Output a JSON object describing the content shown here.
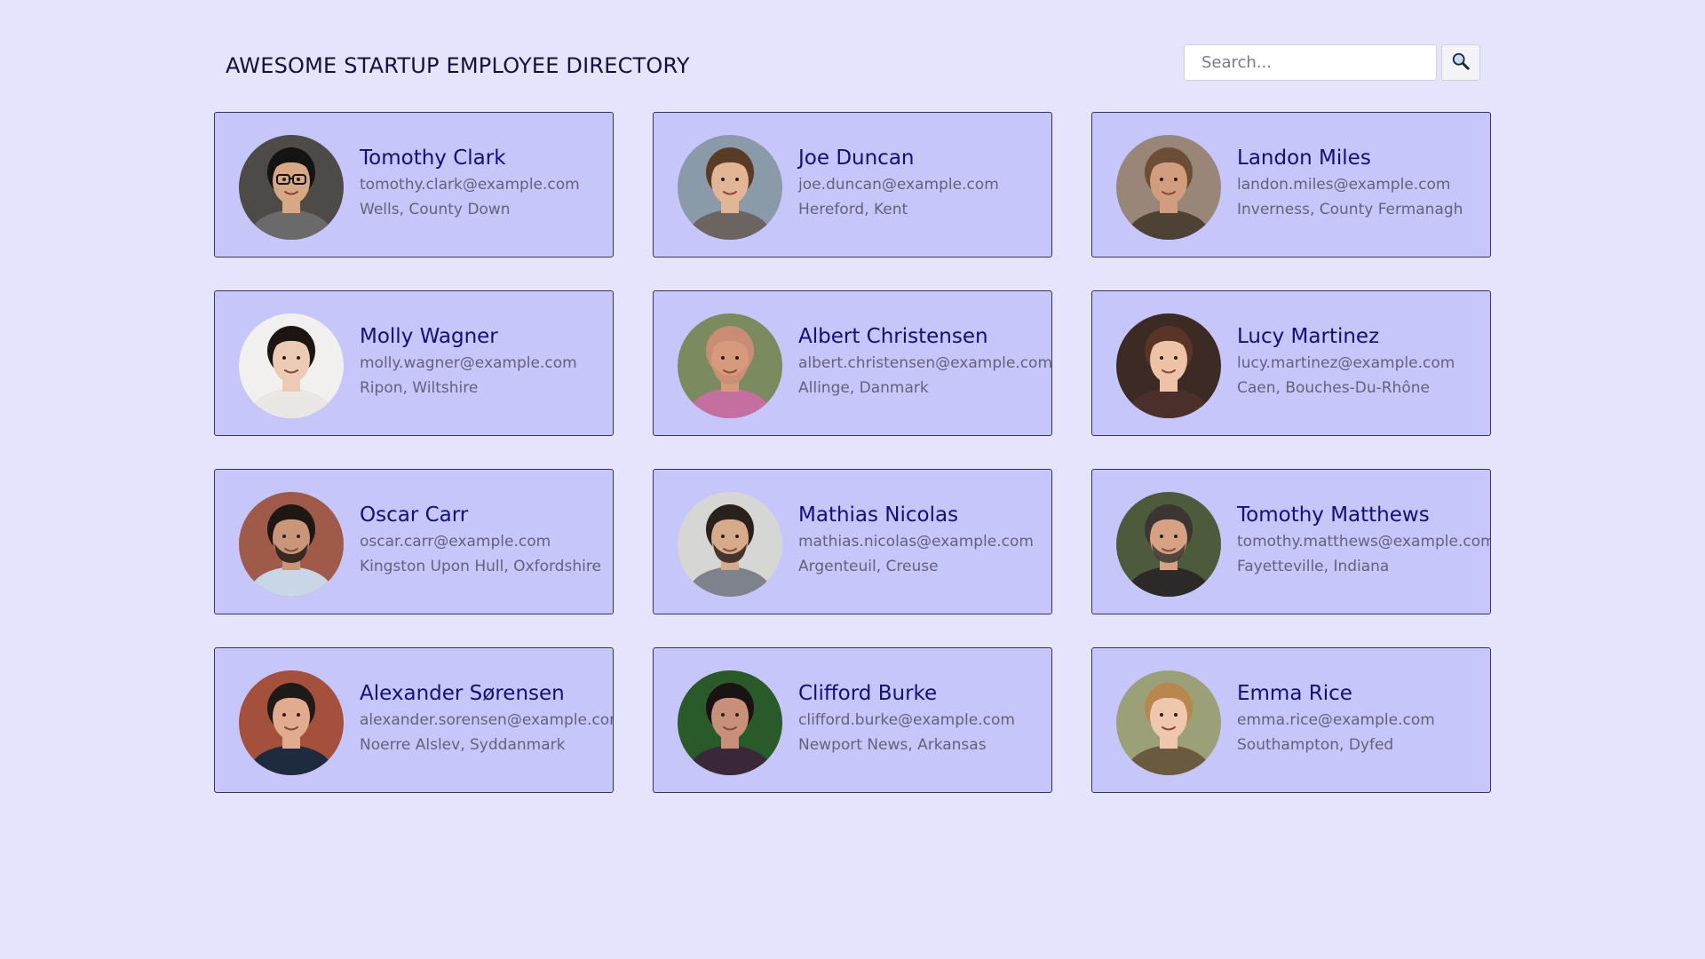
{
  "header": {
    "title": "AWESOME STARTUP EMPLOYEE DIRECTORY"
  },
  "search": {
    "placeholder": "Search...",
    "value": "",
    "button_icon": "magnifying-glass-icon"
  },
  "colors": {
    "background": "#e6e4fc",
    "card": "#c6c6fb",
    "card_border": "#34345e",
    "name": "#10107a",
    "secondary_text": "#62627a"
  },
  "employees": [
    {
      "name": "Tomothy Clark",
      "email": "tomothy.clark@example.com",
      "location": "Wells, County Down",
      "photo": {
        "bg": "#4d4a48",
        "skin": "#d8a783",
        "hair": "#141414",
        "shirt": "#6a6a6a",
        "glasses": true,
        "beard": false
      }
    },
    {
      "name": "Joe Duncan",
      "email": "joe.duncan@example.com",
      "location": "Hereford, Kent",
      "photo": {
        "bg": "#8a9aa8",
        "skin": "#e2b596",
        "hair": "#5a3c26",
        "shirt": "#6b6460",
        "glasses": false,
        "beard": false
      }
    },
    {
      "name": "Landon Miles",
      "email": "landon.miles@example.com",
      "location": "Inverness, County Fermanagh",
      "photo": {
        "bg": "#9a8678",
        "skin": "#d29d7e",
        "hair": "#6b4e35",
        "shirt": "#4e4236",
        "glasses": false,
        "beard": false
      }
    },
    {
      "name": "Molly Wagner",
      "email": "molly.wagner@example.com",
      "location": "Ripon, Wiltshire",
      "photo": {
        "bg": "#f2f0ee",
        "skin": "#eccab3",
        "hair": "#1c1512",
        "shirt": "#e9e6e3",
        "glasses": false,
        "beard": false
      }
    },
    {
      "name": "Albert Christensen",
      "email": "albert.christensen@example.com",
      "location": "Allinge, Danmark",
      "photo": {
        "bg": "#7c8a5f",
        "skin": "#d89a7c",
        "hair": "#c98d76",
        "shirt": "#c56ea0",
        "glasses": false,
        "beard": true
      }
    },
    {
      "name": "Lucy Martinez",
      "email": "lucy.martinez@example.com",
      "location": "Caen, Bouches-Du-Rhône",
      "photo": {
        "bg": "#3c2a24",
        "skin": "#edc2a7",
        "hair": "#5b3426",
        "shirt": "#4a2f2a",
        "glasses": false,
        "beard": false
      }
    },
    {
      "name": "Oscar Carr",
      "email": "oscar.carr@example.com",
      "location": "Kingston Upon Hull, Oxfordshire",
      "photo": {
        "bg": "#a05a4a",
        "skin": "#c9967a",
        "hair": "#1f1713",
        "shirt": "#c8d6e8",
        "glasses": false,
        "beard": true
      }
    },
    {
      "name": "Mathias Nicolas",
      "email": "mathias.nicolas@example.com",
      "location": "Argenteuil, Creuse",
      "photo": {
        "bg": "#d6d6d4",
        "skin": "#d8aa8c",
        "hair": "#2b211c",
        "shirt": "#7d828c",
        "glasses": false,
        "beard": true
      }
    },
    {
      "name": "Tomothy Matthews",
      "email": "tomothy.matthews@example.com",
      "location": "Fayetteville, Indiana",
      "photo": {
        "bg": "#4d5a3c",
        "skin": "#d6a283",
        "hair": "#3c3632",
        "shirt": "#2c2a28",
        "glasses": false,
        "beard": true
      }
    },
    {
      "name": "Alexander Sørensen",
      "email": "alexander.sorensen@example.com",
      "location": "Noerre Alslev, Syddanmark",
      "photo": {
        "bg": "#a4503c",
        "skin": "#e0ab8e",
        "hair": "#1e1a18",
        "shirt": "#1e2a3e",
        "glasses": false,
        "beard": false
      }
    },
    {
      "name": "Clifford Burke",
      "email": "clifford.burke@example.com",
      "location": "Newport News, Arkansas",
      "photo": {
        "bg": "#2a5a2a",
        "skin": "#c8907a",
        "hair": "#1a1214",
        "shirt": "#3a2838",
        "glasses": false,
        "beard": false
      }
    },
    {
      "name": "Emma Rice",
      "email": "emma.rice@example.com",
      "location": "Southampton, Dyfed",
      "photo": {
        "bg": "#9ca078",
        "skin": "#eec7ad",
        "hair": "#b8874e",
        "shirt": "#6a5a40",
        "glasses": false,
        "beard": false
      }
    }
  ]
}
